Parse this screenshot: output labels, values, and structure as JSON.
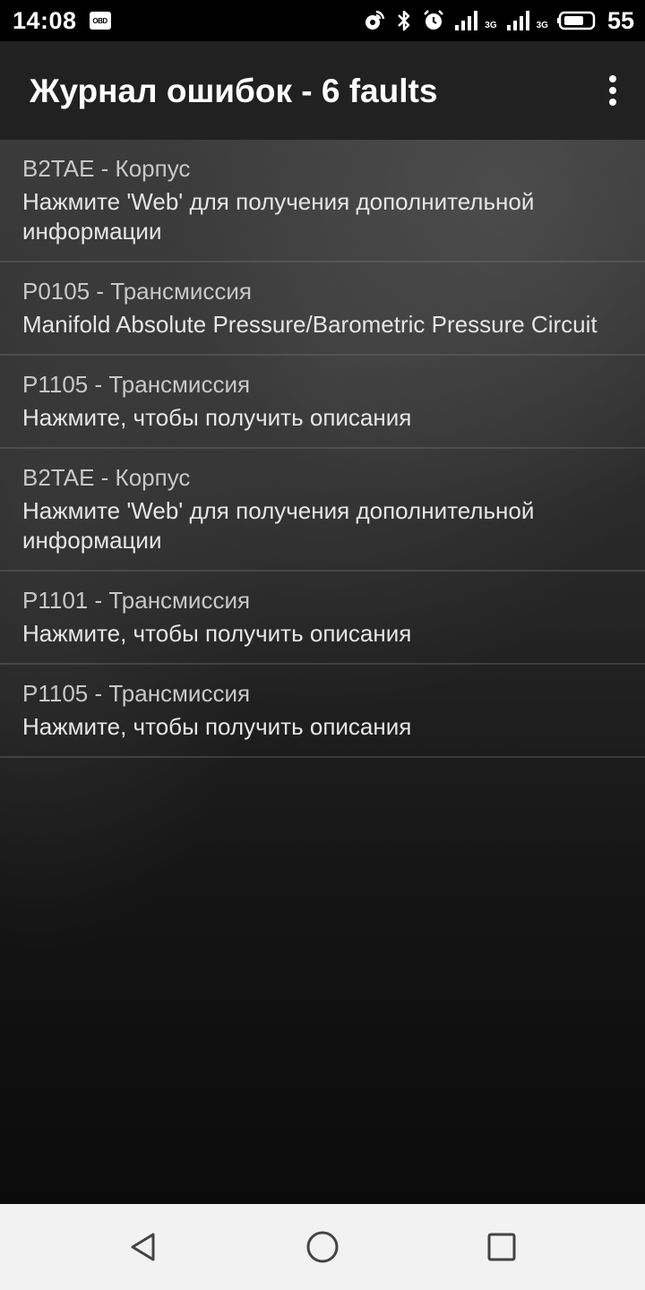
{
  "status_bar": {
    "time": "14:08",
    "obd_badge": "OBD",
    "network_1": "3G",
    "network_2": "3G",
    "battery_level": "55"
  },
  "app_bar": {
    "title": "Журнал ошибок - 6 faults"
  },
  "faults": [
    {
      "code": "B2TAE - Корпус",
      "description": "Нажмите 'Web' для получения дополнительной информации"
    },
    {
      "code": "P0105 - Трансмиссия",
      "description": "Manifold Absolute Pressure/Barometric Pressure Circuit"
    },
    {
      "code": "P1105 - Трансмиссия",
      "description": "Нажмите, чтобы получить описания"
    },
    {
      "code": "B2TAE - Корпус",
      "description": "Нажмите 'Web' для получения дополнительной информации"
    },
    {
      "code": "P1101 - Трансмиссия",
      "description": "Нажмите, чтобы получить описания"
    },
    {
      "code": "P1105 - Трансмиссия",
      "description": "Нажмите, чтобы получить описания"
    }
  ],
  "icons": {
    "overflow": "more-vert-icon",
    "nav_back": "back-triangle-icon",
    "nav_home": "home-circle-icon",
    "nav_recents": "recents-square-icon"
  },
  "colors": {
    "status_bar_bg": "#000000",
    "app_bar_bg": "#212121",
    "nav_bar_bg": "#f2f2f2",
    "text_primary": "#e6e6e6",
    "text_secondary": "#c8c8c8"
  }
}
